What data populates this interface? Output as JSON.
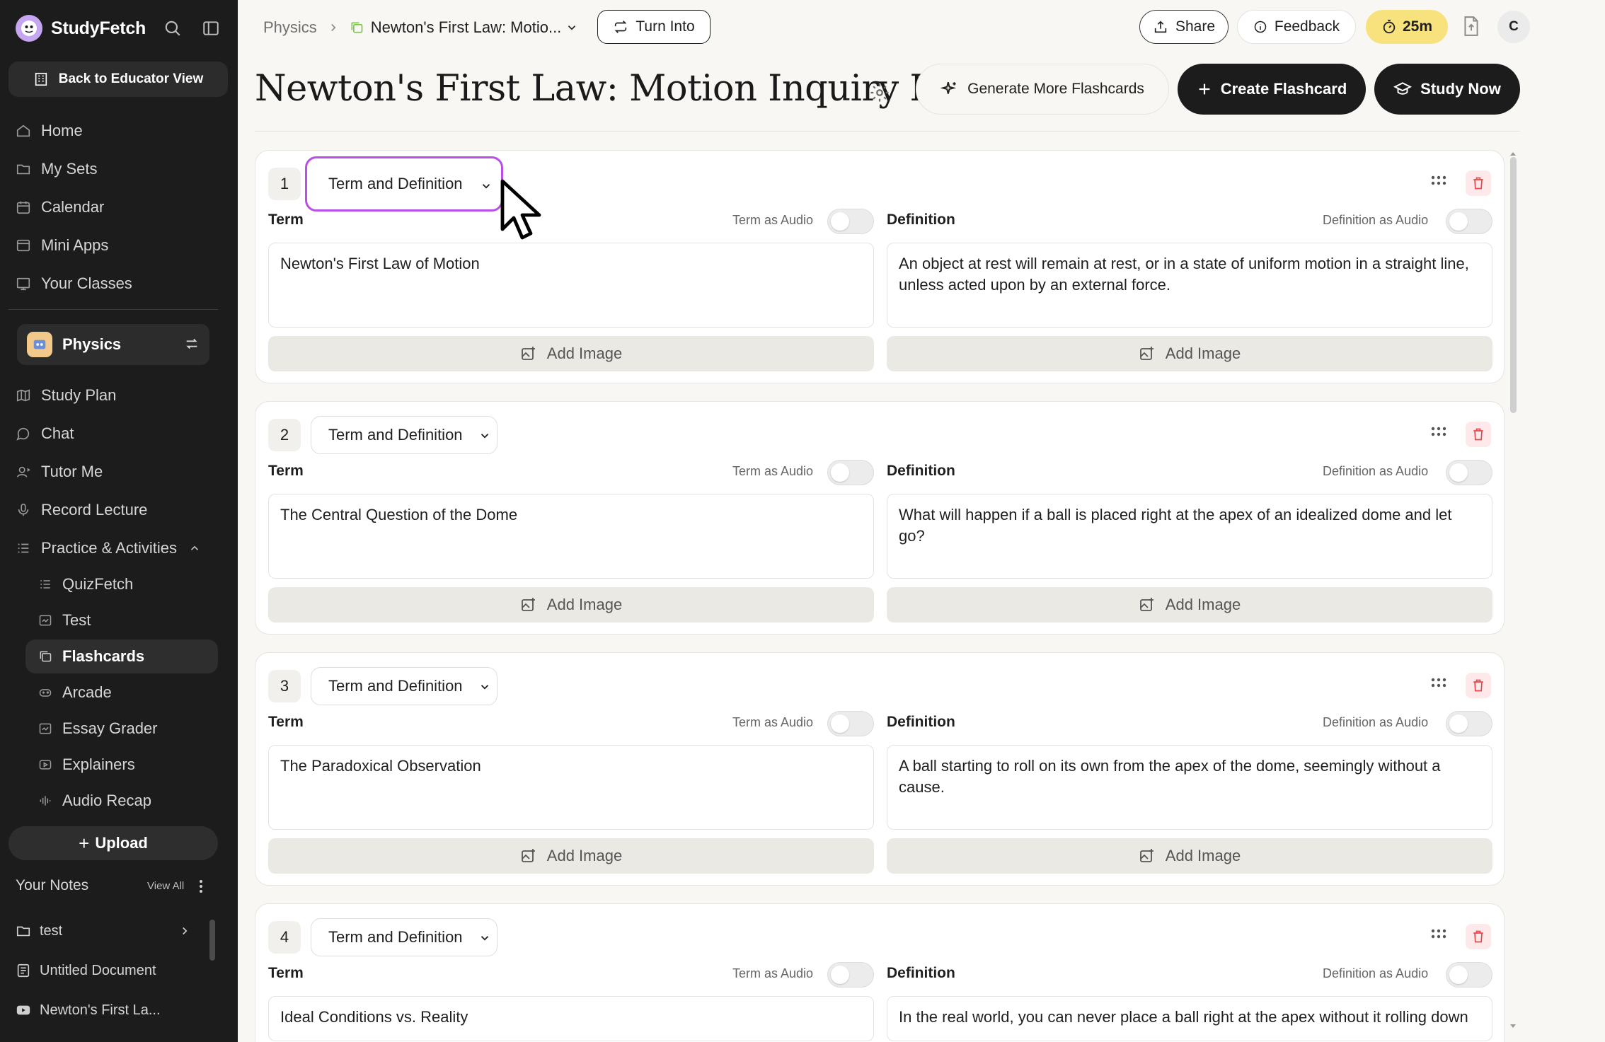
{
  "sidebar": {
    "brand": "StudyFetch",
    "educator_button": "Back to Educator View",
    "nav": [
      {
        "label": "Home",
        "icon": "home-icon"
      },
      {
        "label": "My Sets",
        "icon": "folder-icon"
      },
      {
        "label": "Calendar",
        "icon": "calendar-icon"
      },
      {
        "label": "Mini Apps",
        "icon": "window-icon"
      },
      {
        "label": "Your Classes",
        "icon": "classes-icon"
      }
    ],
    "class_name": "Physics",
    "class_nav": [
      {
        "label": "Study Plan",
        "icon": "map-icon"
      },
      {
        "label": "Chat",
        "icon": "chat-icon"
      },
      {
        "label": "Tutor Me",
        "icon": "tutor-icon"
      },
      {
        "label": "Record Lecture",
        "icon": "mic-icon"
      },
      {
        "label": "Practice & Activities",
        "icon": "list-icon"
      }
    ],
    "practice_items": [
      {
        "label": "QuizFetch",
        "icon": "quiz-icon"
      },
      {
        "label": "Test",
        "icon": "test-icon"
      },
      {
        "label": "Flashcards",
        "icon": "flashcards-icon",
        "active": true
      },
      {
        "label": "Arcade",
        "icon": "gamepad-icon"
      },
      {
        "label": "Essay Grader",
        "icon": "essay-icon"
      },
      {
        "label": "Explainers",
        "icon": "video-icon"
      },
      {
        "label": "Audio Recap",
        "icon": "audio-icon"
      }
    ],
    "upload_label": "Upload",
    "notes_title": "Your Notes",
    "notes_view_all": "View All",
    "notes": [
      {
        "label": "test",
        "icon": "folder-icon"
      },
      {
        "label": "Untitled Document",
        "icon": "document-icon"
      },
      {
        "label": "Newton's First La...",
        "icon": "youtube-icon"
      }
    ]
  },
  "topbar": {
    "crumb_root": "Physics",
    "crumb_current": "Newton's First Law: Motio...",
    "turn_into": "Turn Into",
    "share": "Share",
    "feedback": "Feedback",
    "timer": "25m",
    "avatar_initial": "C"
  },
  "header": {
    "title": "Newton's First Law: Motion Inquiry F...",
    "generate_more": "Generate More Flashcards",
    "create": "Create Flashcard",
    "study": "Study Now"
  },
  "labels": {
    "term": "Term",
    "definition": "Definition",
    "term_audio": "Term as Audio",
    "definition_audio": "Definition as Audio",
    "add_image": "Add Image"
  },
  "cards": [
    {
      "number": "1",
      "type": "Term and Definition",
      "term": "Newton's First Law of Motion",
      "definition": "An object at rest will remain at rest, or in a state of uniform motion in a straight line, unless acted upon by an external force."
    },
    {
      "number": "2",
      "type": "Term and Definition",
      "term": "The Central Question of the Dome",
      "definition": "What will happen if a ball is placed right at the apex of an idealized dome and let go?"
    },
    {
      "number": "3",
      "type": "Term and Definition",
      "term": "The Paradoxical Observation",
      "definition": "A ball starting to roll on its own from the apex of the dome, seemingly without a cause."
    },
    {
      "number": "4",
      "type": "Term and Definition",
      "term": "Ideal Conditions vs. Reality",
      "definition": "In the real world, you can never place a ball right at the apex without it rolling down"
    }
  ],
  "colors": {
    "accent_focus": "#b94fe6",
    "timer_bg": "#f7e27d",
    "delete_red": "#e5484d",
    "sidebar_bg": "#1c1c1c"
  }
}
